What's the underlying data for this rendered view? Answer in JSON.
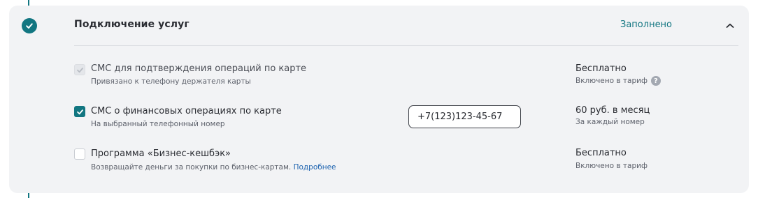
{
  "section": {
    "title": "Подключение услуг",
    "status": "Заполнено"
  },
  "services": [
    {
      "title": "СМС для подтверждения операций по карте",
      "subtitle": "Привязано к телефону держателя карты",
      "price": "Бесплатно",
      "price_note": "Включено в тариф",
      "checked": true,
      "disabled": true
    },
    {
      "title": "СМС о финансовых операциях по карте",
      "subtitle": "На выбранный телефонный номер",
      "phone_value": "+7(123)123-45-67",
      "price": "60 руб. в месяц",
      "price_note": "За каждый номер",
      "checked": true,
      "disabled": false
    },
    {
      "title": "Программа «Бизнес-кешбэк»",
      "subtitle": "Возвращайте деньги за покупки по бизнес-картам.",
      "link_label": "Подробнее",
      "price": "Бесплатно",
      "price_note": "Включено в тариф",
      "checked": false,
      "disabled": false
    }
  ],
  "colors": {
    "accent": "#127681",
    "card_background": "#f2f3f5",
    "link": "#1f64b0"
  },
  "icons": {
    "step_marker": "check-icon",
    "collapse": "chevron-up-icon",
    "help": "question-icon"
  }
}
